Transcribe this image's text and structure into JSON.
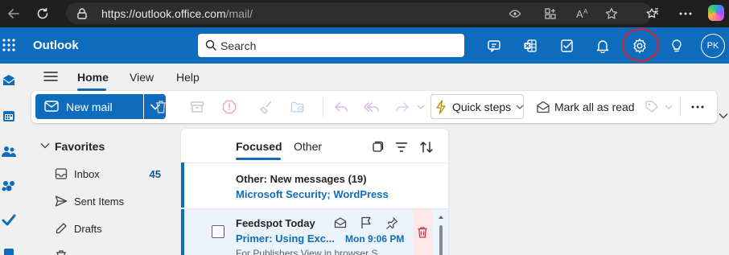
{
  "browser": {
    "url_host": "https://outlook.office.com",
    "url_path": "/mail/",
    "icons": [
      "back-icon",
      "refresh-icon",
      "site-info-icon",
      "eye-icon",
      "apps-icon",
      "read-aloud-icon",
      "favorite-icon",
      "collections-icon",
      "more-icon",
      "copilot-icon"
    ]
  },
  "header": {
    "app_name": "Outlook",
    "search_placeholder": "Search",
    "icons": [
      "teams-chat-icon",
      "excel-icon",
      "todo-icon",
      "bell-icon",
      "gear-icon",
      "lightbulb-icon"
    ],
    "avatar_initials": "PK",
    "highlight_color": "#e0202a"
  },
  "ribbon": {
    "tabs": [
      {
        "label": "Home",
        "active": true
      },
      {
        "label": "View",
        "active": false
      },
      {
        "label": "Help",
        "active": false
      }
    ]
  },
  "toolbar": {
    "new_mail": "New mail",
    "quick_steps": "Quick steps",
    "mark_all_read": "Mark all as read",
    "icons": [
      "trash-icon",
      "archive-icon",
      "report-icon",
      "sweep-icon",
      "move-folder-icon",
      "reply-icon",
      "reply-all-icon",
      "forward-icon",
      "lightning-icon",
      "tag-icon",
      "more-icon"
    ]
  },
  "folders": {
    "section": "Favorites",
    "items": [
      {
        "label": "Inbox",
        "count": "45",
        "icon": "inbox-icon"
      },
      {
        "label": "Sent Items",
        "count": "",
        "icon": "send-icon"
      },
      {
        "label": "Drafts",
        "count": "",
        "icon": "draft-icon"
      }
    ]
  },
  "message_list": {
    "tabs": [
      {
        "label": "Focused",
        "active": true
      },
      {
        "label": "Other",
        "active": false
      }
    ],
    "other_banner": {
      "title": "Other: New messages (19)",
      "subtitle": "Microsoft Security; WordPress"
    },
    "messages": [
      {
        "sender": "Feedspot Today",
        "subject": "Primer: Using Exc...",
        "time": "Mon 9:06 PM",
        "preview": "For Publishers View in browser S"
      }
    ]
  },
  "colors": {
    "brand": "#0f6cbd",
    "browser_bg": "#1f1f1f",
    "page_bg": "#f0f0f0"
  }
}
